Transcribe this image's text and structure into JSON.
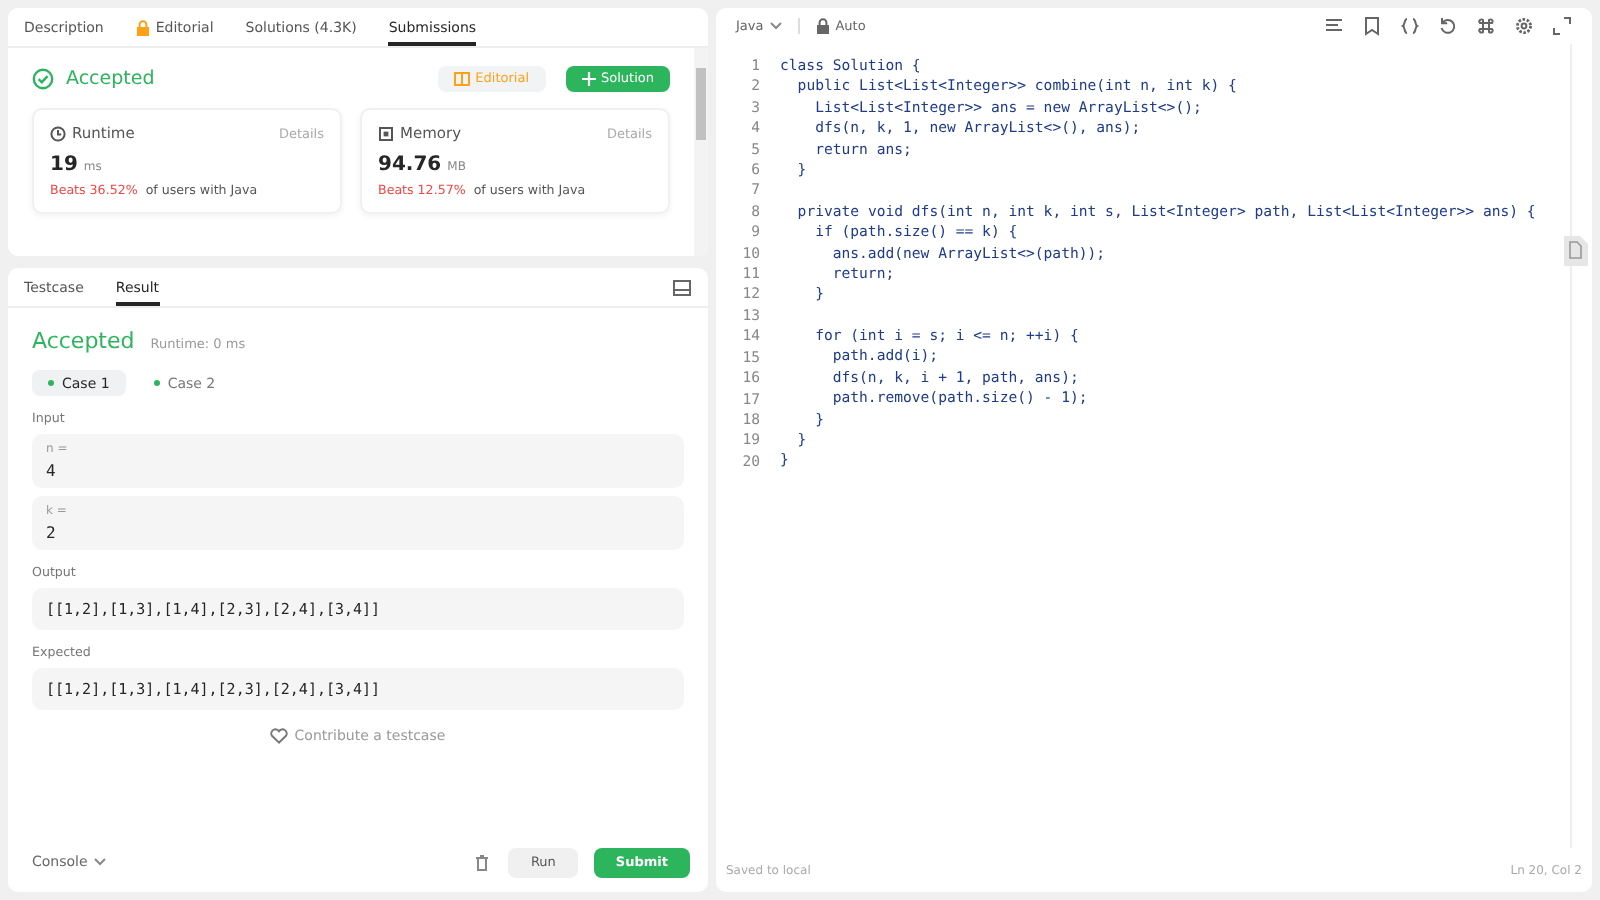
{
  "description_panel": {
    "tabs": [
      {
        "label": "Description",
        "selected": false,
        "locked": false
      },
      {
        "label": "Editorial",
        "selected": false,
        "locked": true
      },
      {
        "label": "Solutions (4.3K)",
        "selected": false,
        "locked": false
      },
      {
        "label": "Submissions",
        "selected": true,
        "locked": false
      }
    ],
    "status": "Accepted",
    "editorial_button": "Editorial",
    "solution_button": "Solution",
    "metrics": [
      {
        "kind": "runtime",
        "label": "Runtime",
        "details": "Details",
        "value": "19",
        "unit": "ms",
        "beats": "Beats 36.52%",
        "note": "of users with Java"
      },
      {
        "kind": "memory",
        "label": "Memory",
        "details": "Details",
        "value": "94.76",
        "unit": "MB",
        "beats": "Beats 12.57%",
        "note": "of users with Java"
      }
    ]
  },
  "console_panel": {
    "tabs": [
      {
        "label": "Testcase",
        "selected": false
      },
      {
        "label": "Result",
        "selected": true
      }
    ],
    "status": "Accepted",
    "runtime": "Runtime: 0 ms",
    "cases": [
      {
        "label": "Case 1",
        "selected": true
      },
      {
        "label": "Case 2",
        "selected": false
      }
    ],
    "input_label": "Input",
    "inputs": [
      {
        "name": "n =",
        "value": "4"
      },
      {
        "name": "k =",
        "value": "2"
      }
    ],
    "output_label": "Output",
    "output": "[[1,2],[1,3],[1,4],[2,3],[2,4],[3,4]]",
    "expected_label": "Expected",
    "expected": "[[1,2],[1,3],[1,4],[2,3],[2,4],[3,4]]",
    "contribute": "Contribute a testcase",
    "console_button": "Console",
    "run_button": "Run",
    "submit_button": "Submit"
  },
  "editor": {
    "language": "Java",
    "mode": "Auto",
    "lines": [
      {
        "number": "1",
        "text": "class Solution {"
      },
      {
        "number": "2",
        "text": "  public List<List<Integer>> combine(int n, int k) {"
      },
      {
        "number": "3",
        "text": "    List<List<Integer>> ans = new ArrayList<>();"
      },
      {
        "number": "4",
        "text": "    dfs(n, k, 1, new ArrayList<>(), ans);"
      },
      {
        "number": "5",
        "text": "    return ans;"
      },
      {
        "number": "6",
        "text": "  }"
      },
      {
        "number": "7"
      },
      {
        "number": "8",
        "text": "  private void dfs(int n, int k, int s, List<Integer> path, List<List<Integer>> ans) {"
      },
      {
        "number": "9",
        "text": "    if (path.size() == k) {"
      },
      {
        "number": "10",
        "text": "      ans.add(new ArrayList<>(path));"
      },
      {
        "number": "11",
        "text": "      return;"
      },
      {
        "number": "12",
        "text": "    }"
      },
      {
        "number": "13"
      },
      {
        "number": "14",
        "text": "    for (int i = s; i <= n; ++i) {"
      },
      {
        "number": "15",
        "text": "      path.add(i);"
      },
      {
        "number": "16",
        "text": "      dfs(n, k, i + 1, path, ans);"
      },
      {
        "number": "17",
        "text": "      path.remove(path.size() - 1);"
      },
      {
        "number": "18",
        "text": "    }"
      },
      {
        "number": "19",
        "text": "  }"
      },
      {
        "number": "20",
        "text": "}"
      }
    ],
    "saved": "Saved to local",
    "cursor": "Ln 20, Col 2"
  }
}
